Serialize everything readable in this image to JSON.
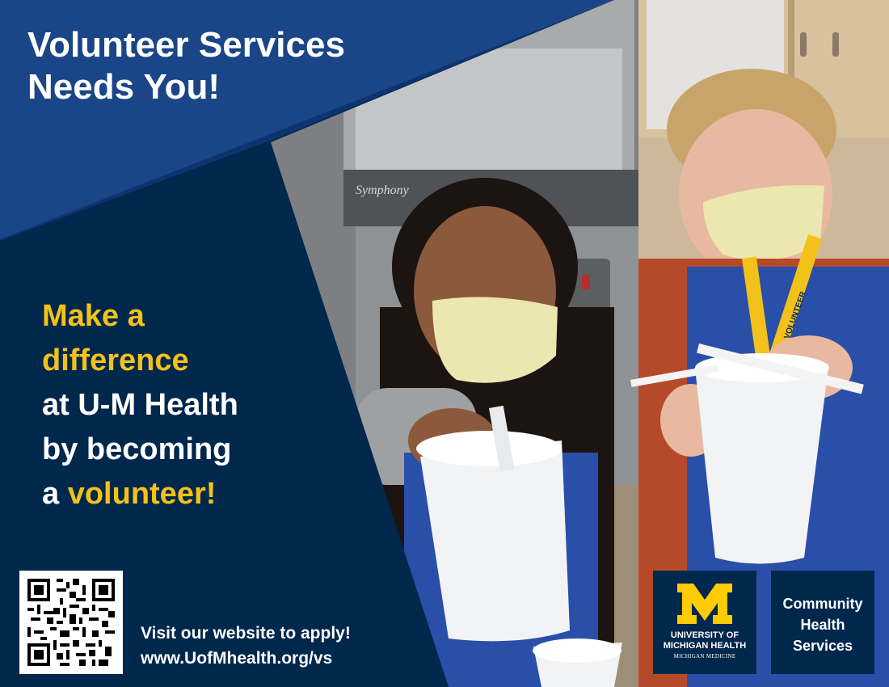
{
  "headline": {
    "line1": "Volunteer Services",
    "line2": "Needs You!"
  },
  "tagline": {
    "part1": "Make a",
    "part2": "difference",
    "part3": "at U-M Health",
    "part4": "by becoming",
    "part5_prefix": "a",
    "part5_accent": "volunteer!"
  },
  "apply": {
    "line1": "Visit our website to apply!",
    "line2": "www.UofMhealth.org/vs"
  },
  "photo_details": {
    "machine_brand": "Symphony",
    "lanyard_text": "VOLUNTEER"
  },
  "logos": {
    "um_line1": "UNIVERSITY OF",
    "um_line2": "MICHIGAN HEALTH",
    "um_sub": "MICHIGAN MEDICINE",
    "chs_line1": "Community",
    "chs_line2": "Health",
    "chs_line3": "Services"
  },
  "colors": {
    "navy": "#00274c",
    "blue": "#1a4587",
    "maize": "#f3c21a"
  }
}
